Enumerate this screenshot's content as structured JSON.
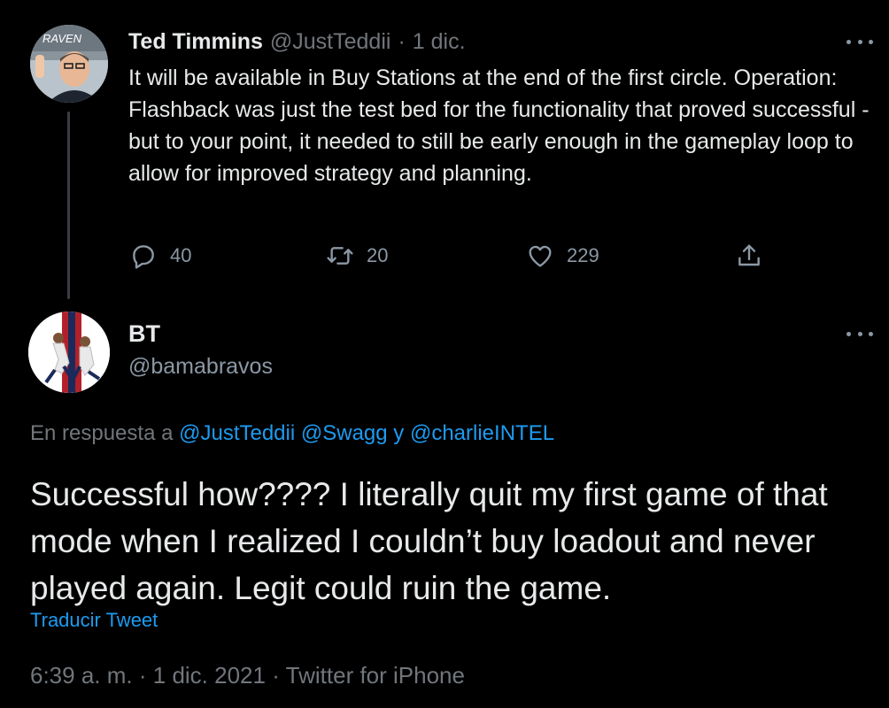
{
  "parent_tweet": {
    "name": "Ted Timmins",
    "handle": "@JustTeddii",
    "separator": "·",
    "time": "1 dic.",
    "text": "It will be available in Buy Stations at the end of the first circle. Operation: Flashback was just the test bed for the functionality that proved successful - but to your point, it needed to still be early enough in the gameplay loop to allow for improved strategy and planning.",
    "avatar_sign": "RAVEN",
    "actions": {
      "replies": "40",
      "retweets": "20",
      "likes": "229"
    }
  },
  "reply_tweet": {
    "name": "BT",
    "handle": "@bamabravos",
    "reply_prefix": "En respuesta a",
    "mention_1": "@JustTeddii",
    "mention_2": "@Swagg",
    "conjunction": "y",
    "mention_3": "@charlieINTEL",
    "text": "Successful how???? I literally quit my first game of that mode when I realized I couldn’t buy loadout and never played again. Legit could ruin the game.",
    "translate_label": "Traducir Tweet",
    "timestamp": "6:39 a. m.",
    "date": "1 dic. 2021",
    "source": "Twitter for iPhone",
    "meta_separator": "·"
  },
  "colors": {
    "background": "#000000",
    "text": "#e7e9ea",
    "muted": "#71767b",
    "link": "#1d9bf0"
  },
  "icons": [
    "reply-icon",
    "retweet-icon",
    "like-icon",
    "share-icon",
    "more-icon"
  ]
}
